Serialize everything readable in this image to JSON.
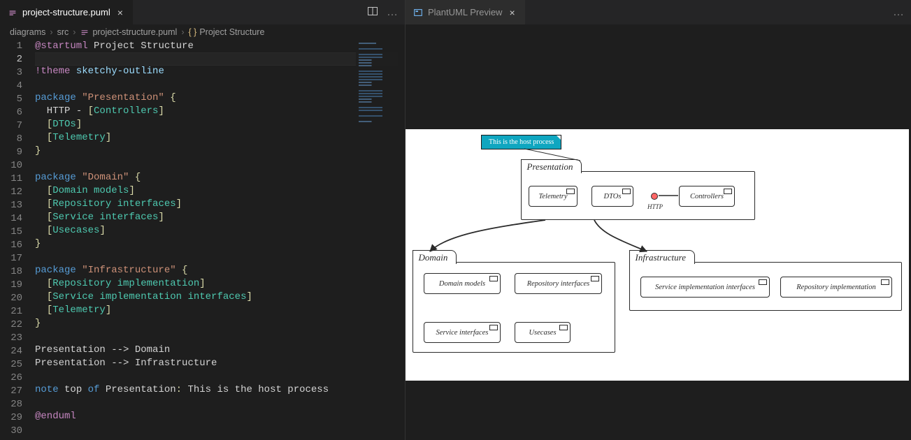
{
  "left": {
    "tab": {
      "title": "project-structure.puml",
      "icon": "file-icon"
    },
    "actions": {
      "split": "split-editor-icon",
      "more": "…"
    },
    "breadcrumb": {
      "parts": [
        "diagrams",
        "src",
        "project-structure.puml",
        "Project Structure"
      ]
    },
    "activeLine": 2,
    "code": [
      {
        "n": 1,
        "spans": [
          [
            "tok-dir",
            "@startuml"
          ],
          [
            "tok-name",
            " Project Structure"
          ]
        ]
      },
      {
        "n": 2,
        "spans": []
      },
      {
        "n": 3,
        "spans": [
          [
            "tok-dir",
            "!theme"
          ],
          [
            "tok-name",
            " "
          ],
          [
            "tok-theme",
            "sketchy-outline"
          ]
        ]
      },
      {
        "n": 4,
        "spans": []
      },
      {
        "n": 5,
        "spans": [
          [
            "tok-kw",
            "package"
          ],
          [
            "tok-name",
            " "
          ],
          [
            "tok-str",
            "\"Presentation\""
          ],
          [
            "tok-name",
            " "
          ],
          [
            "tok-punc",
            "{"
          ]
        ]
      },
      {
        "n": 6,
        "spans": [
          [
            "tok-name",
            "  HTTP "
          ],
          [
            "tok-arrow",
            "-"
          ],
          [
            "tok-name",
            " "
          ],
          [
            "tok-punc",
            "["
          ],
          [
            "tok-comp",
            "Controllers"
          ],
          [
            "tok-punc",
            "]"
          ]
        ]
      },
      {
        "n": 7,
        "spans": [
          [
            "tok-name",
            "  "
          ],
          [
            "tok-punc",
            "["
          ],
          [
            "tok-comp",
            "DTOs"
          ],
          [
            "tok-punc",
            "]"
          ]
        ]
      },
      {
        "n": 8,
        "spans": [
          [
            "tok-name",
            "  "
          ],
          [
            "tok-punc",
            "["
          ],
          [
            "tok-comp",
            "Telemetry"
          ],
          [
            "tok-punc",
            "]"
          ]
        ]
      },
      {
        "n": 9,
        "spans": [
          [
            "tok-punc",
            "}"
          ]
        ]
      },
      {
        "n": 10,
        "spans": []
      },
      {
        "n": 11,
        "spans": [
          [
            "tok-kw",
            "package"
          ],
          [
            "tok-name",
            " "
          ],
          [
            "tok-str",
            "\"Domain\""
          ],
          [
            "tok-name",
            " "
          ],
          [
            "tok-punc",
            "{"
          ]
        ]
      },
      {
        "n": 12,
        "spans": [
          [
            "tok-name",
            "  "
          ],
          [
            "tok-punc",
            "["
          ],
          [
            "tok-comp",
            "Domain models"
          ],
          [
            "tok-punc",
            "]"
          ]
        ]
      },
      {
        "n": 13,
        "spans": [
          [
            "tok-name",
            "  "
          ],
          [
            "tok-punc",
            "["
          ],
          [
            "tok-comp",
            "Repository interfaces"
          ],
          [
            "tok-punc",
            "]"
          ]
        ]
      },
      {
        "n": 14,
        "spans": [
          [
            "tok-name",
            "  "
          ],
          [
            "tok-punc",
            "["
          ],
          [
            "tok-comp",
            "Service interfaces"
          ],
          [
            "tok-punc",
            "]"
          ]
        ]
      },
      {
        "n": 15,
        "spans": [
          [
            "tok-name",
            "  "
          ],
          [
            "tok-punc",
            "["
          ],
          [
            "tok-comp",
            "Usecases"
          ],
          [
            "tok-punc",
            "]"
          ]
        ]
      },
      {
        "n": 16,
        "spans": [
          [
            "tok-punc",
            "}"
          ]
        ]
      },
      {
        "n": 17,
        "spans": []
      },
      {
        "n": 18,
        "spans": [
          [
            "tok-kw",
            "package"
          ],
          [
            "tok-name",
            " "
          ],
          [
            "tok-str",
            "\"Infrastructure\""
          ],
          [
            "tok-name",
            " "
          ],
          [
            "tok-punc",
            "{"
          ]
        ]
      },
      {
        "n": 19,
        "spans": [
          [
            "tok-name",
            "  "
          ],
          [
            "tok-punc",
            "["
          ],
          [
            "tok-comp",
            "Repository implementation"
          ],
          [
            "tok-punc",
            "]"
          ]
        ]
      },
      {
        "n": 20,
        "spans": [
          [
            "tok-name",
            "  "
          ],
          [
            "tok-punc",
            "["
          ],
          [
            "tok-comp",
            "Service implementation interfaces"
          ],
          [
            "tok-punc",
            "]"
          ]
        ]
      },
      {
        "n": 21,
        "spans": [
          [
            "tok-name",
            "  "
          ],
          [
            "tok-punc",
            "["
          ],
          [
            "tok-comp",
            "Telemetry"
          ],
          [
            "tok-punc",
            "]"
          ]
        ]
      },
      {
        "n": 22,
        "spans": [
          [
            "tok-punc",
            "}"
          ]
        ]
      },
      {
        "n": 23,
        "spans": []
      },
      {
        "n": 24,
        "spans": [
          [
            "tok-name",
            "Presentation "
          ],
          [
            "tok-arrow",
            "-->"
          ],
          [
            "tok-name",
            " Domain"
          ]
        ]
      },
      {
        "n": 25,
        "spans": [
          [
            "tok-name",
            "Presentation "
          ],
          [
            "tok-arrow",
            "-->"
          ],
          [
            "tok-name",
            " Infrastructure"
          ]
        ]
      },
      {
        "n": 26,
        "spans": []
      },
      {
        "n": 27,
        "spans": [
          [
            "tok-kw",
            "note"
          ],
          [
            "tok-name",
            " top "
          ],
          [
            "tok-kw",
            "of"
          ],
          [
            "tok-name",
            " Presentation"
          ],
          [
            "tok-punc",
            ":"
          ],
          [
            "tok-name",
            " This is the host process"
          ]
        ]
      },
      {
        "n": 28,
        "spans": []
      },
      {
        "n": 29,
        "spans": [
          [
            "tok-dir",
            "@enduml"
          ]
        ]
      },
      {
        "n": 30,
        "spans": []
      }
    ]
  },
  "right": {
    "tab": {
      "title": "PlantUML Preview",
      "icon": "preview-icon"
    },
    "actions": {
      "more": "…"
    },
    "diagram": {
      "note": "This is the host process",
      "packages": {
        "presentation": {
          "label": "Presentation",
          "components": [
            "Telemetry",
            "DTOs",
            "Controllers"
          ],
          "interface": "HTTP"
        },
        "domain": {
          "label": "Domain",
          "components": [
            "Domain models",
            "Repository interfaces",
            "Service interfaces",
            "Usecases"
          ]
        },
        "infrastructure": {
          "label": "Infrastructure",
          "components": [
            "Service implementation interfaces",
            "Repository implementation"
          ]
        }
      }
    }
  }
}
